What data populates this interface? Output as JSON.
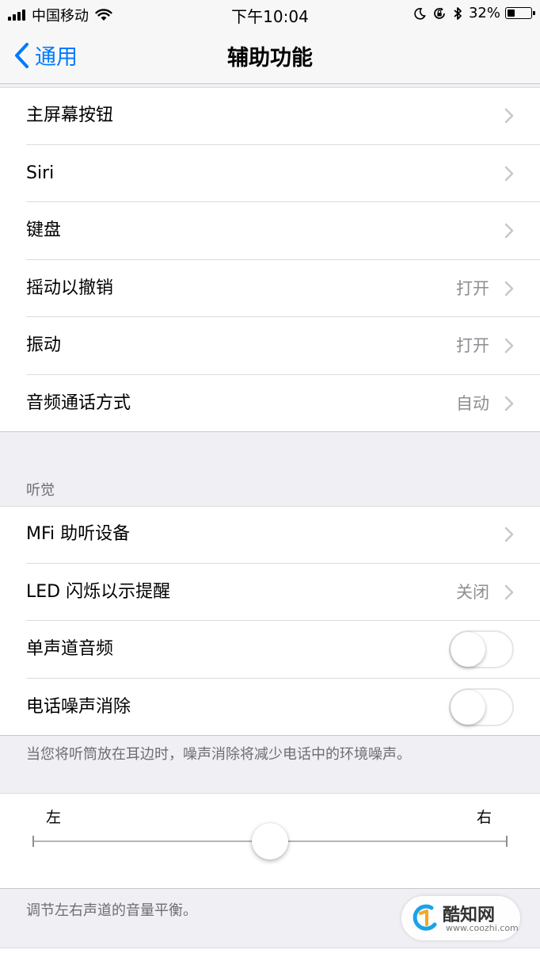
{
  "status_bar": {
    "carrier": "中国移动",
    "time": "下午10:04",
    "battery_text": "32%",
    "battery_level": 0.32,
    "icons": [
      "signal-icon",
      "wifi-icon",
      "moon-icon",
      "rotation-lock-icon",
      "bluetooth-icon",
      "battery-icon"
    ]
  },
  "nav": {
    "back_label": "通用",
    "title": "辅助功能"
  },
  "group1": {
    "items": [
      {
        "label": "主屏幕按钮",
        "value": ""
      },
      {
        "label": "Siri",
        "value": ""
      },
      {
        "label": "键盘",
        "value": ""
      },
      {
        "label": "摇动以撤销",
        "value": "打开"
      },
      {
        "label": "振动",
        "value": "打开"
      },
      {
        "label": "音频通话方式",
        "value": "自动"
      }
    ]
  },
  "hearing": {
    "header": "听觉",
    "items": [
      {
        "label": "MFi 助听设备",
        "value": ""
      },
      {
        "label": "LED 闪烁以示提醒",
        "value": "关闭"
      }
    ],
    "toggles": [
      {
        "label": "单声道音频",
        "on": false
      },
      {
        "label": "电话噪声消除",
        "on": false
      }
    ],
    "footer": "当您将听筒放在耳边时，噪声消除将减少电话中的环境噪声。"
  },
  "balance": {
    "left_label": "左",
    "right_label": "右",
    "position": 0.5,
    "footer": "调节左右声道的音量平衡。"
  },
  "watermark": {
    "name": "酷知网",
    "url": "www.coozhi.com"
  },
  "colors": {
    "accent": "#007aff",
    "background": "#efeff4",
    "secondary_text": "#8e8e93"
  }
}
